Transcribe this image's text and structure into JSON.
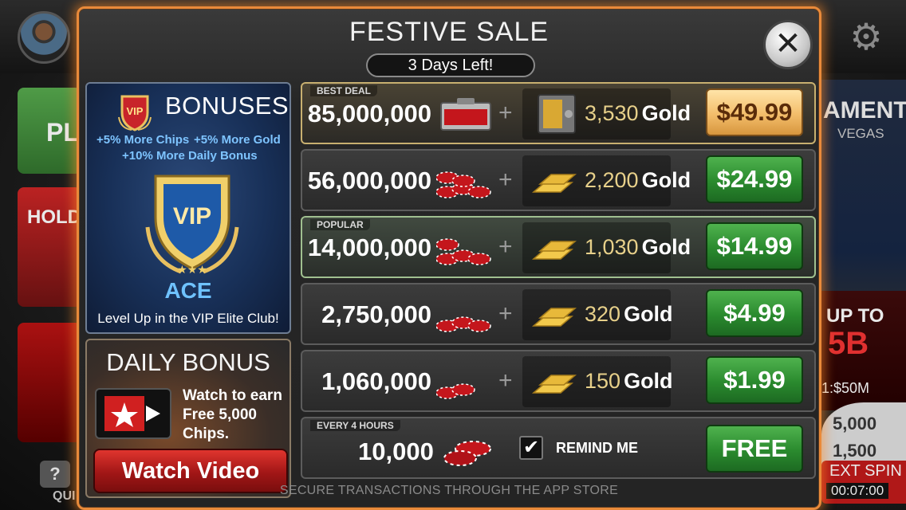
{
  "background": {
    "play_label": "PL",
    "holdem_label": "HOLD",
    "tournament_label": "AMENT",
    "tournament_sub": "VEGAS",
    "upto_label": "UP TO",
    "upto_value": "5B",
    "stake_label": "1:$50M",
    "wheel_top": "5,000",
    "wheel_mid": "1,500",
    "next_spin_label": "EXT SPIN",
    "next_spin_timer": "00:07:00",
    "quiz_label": "QUI",
    "quiz_icon": "?"
  },
  "modal": {
    "title": "FESTIVE SALE",
    "timer": "3 Days Left!",
    "close_glyph": "✕",
    "footer": "SECURE TRANSACTIONS THROUGH THE APP STORE"
  },
  "vip": {
    "title": "BONUSES",
    "badge_text": "VIP",
    "perk_1": "+5% More Chips",
    "perk_2": "+5% More Gold",
    "perk_3": "+10% More Daily Bonus",
    "shield_text": "VIP",
    "rank": "ACE",
    "caption": "Level Up in the VIP Elite Club!"
  },
  "daily": {
    "title": "DAILY BONUS",
    "watch_text": "Watch to earn Free 5,000 Chips.",
    "button": "Watch Video"
  },
  "offers": [
    {
      "tag": "BEST DEAL",
      "chips": "85,000,000",
      "gold": "3,530",
      "gold_word": "Gold",
      "price": "$49.99"
    },
    {
      "tag": "",
      "chips": "56,000,000",
      "gold": "2,200",
      "gold_word": "Gold",
      "price": "$24.99"
    },
    {
      "tag": "POPULAR",
      "chips": "14,000,000",
      "gold": "1,030",
      "gold_word": "Gold",
      "price": "$14.99"
    },
    {
      "tag": "",
      "chips": "2,750,000",
      "gold": "320",
      "gold_word": "Gold",
      "price": "$4.99"
    },
    {
      "tag": "",
      "chips": "1,060,000",
      "gold": "150",
      "gold_word": "Gold",
      "price": "$1.99"
    }
  ],
  "plus_sign": "+",
  "free_offer": {
    "tag": "EVERY 4 HOURS",
    "chips": "10,000",
    "remind_label": "REMIND ME",
    "remind_checked": true,
    "check_glyph": "✔",
    "button": "FREE"
  },
  "colors": {
    "accent_orange": "#e98a3a",
    "price_green": "#2a8a2e",
    "price_gold": "#f3bd6a",
    "vip_blue": "#6fc2ff",
    "watch_red": "#c11f1f"
  }
}
